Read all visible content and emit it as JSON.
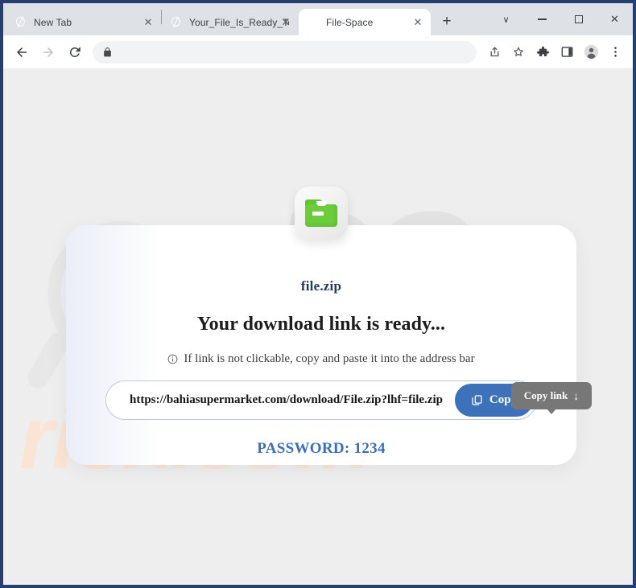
{
  "browser": {
    "tabs": [
      {
        "title": "New Tab",
        "favicon": "globe-icon",
        "active": false,
        "close_label": "✕"
      },
      {
        "title": "Your_File_Is_Ready_To_Downl",
        "favicon": "globe-icon",
        "active": false,
        "close_label": "✕"
      },
      {
        "title": "File-Space",
        "favicon": "globe-icon",
        "active": true,
        "close_label": "✕"
      }
    ],
    "new_tab_label": "+",
    "window_controls": {
      "tab_search": "∨",
      "minimize": "",
      "maximize": "",
      "close": "✕"
    },
    "toolbar": {
      "back": "back-arrow-icon",
      "forward": "forward-arrow-icon",
      "reload": "reload-icon",
      "lock": "lock-icon",
      "address_value": "",
      "share": "share-icon",
      "bookmark": "star-icon",
      "extensions": "puzzle-icon",
      "side_panel": "side-panel-icon",
      "profile": "profile-avatar-icon",
      "menu": "three-dot-menu-icon"
    }
  },
  "page": {
    "watermark_top": "PC",
    "watermark_bottom": "risk.com",
    "file_name": "file.zip",
    "headline": "Your download link is ready...",
    "hint": "If link is not clickable, copy and paste it into the address bar",
    "tooltip": {
      "label": "Copy link",
      "arrow": "↓"
    },
    "download_url": "https://bahiasupermarket.com/download/File.zip?lhf=file.zip",
    "copy_button_label": "Copy",
    "password_line": "PASSWORD: 1234"
  },
  "colors": {
    "window_border": "#25406e",
    "tabstrip": "#dee1e6",
    "page_bg": "#efeeee",
    "card_bg": "#ffffff",
    "accent_blue": "#3d72ba",
    "password_blue": "#3a6fbd",
    "filename_navy": "#1f3864",
    "tooltip_gray": "#777777",
    "folder_green": "#6ccc3b",
    "watermark_orange": "#fbe4d4",
    "watermark_gray": "#e3e3e3"
  }
}
